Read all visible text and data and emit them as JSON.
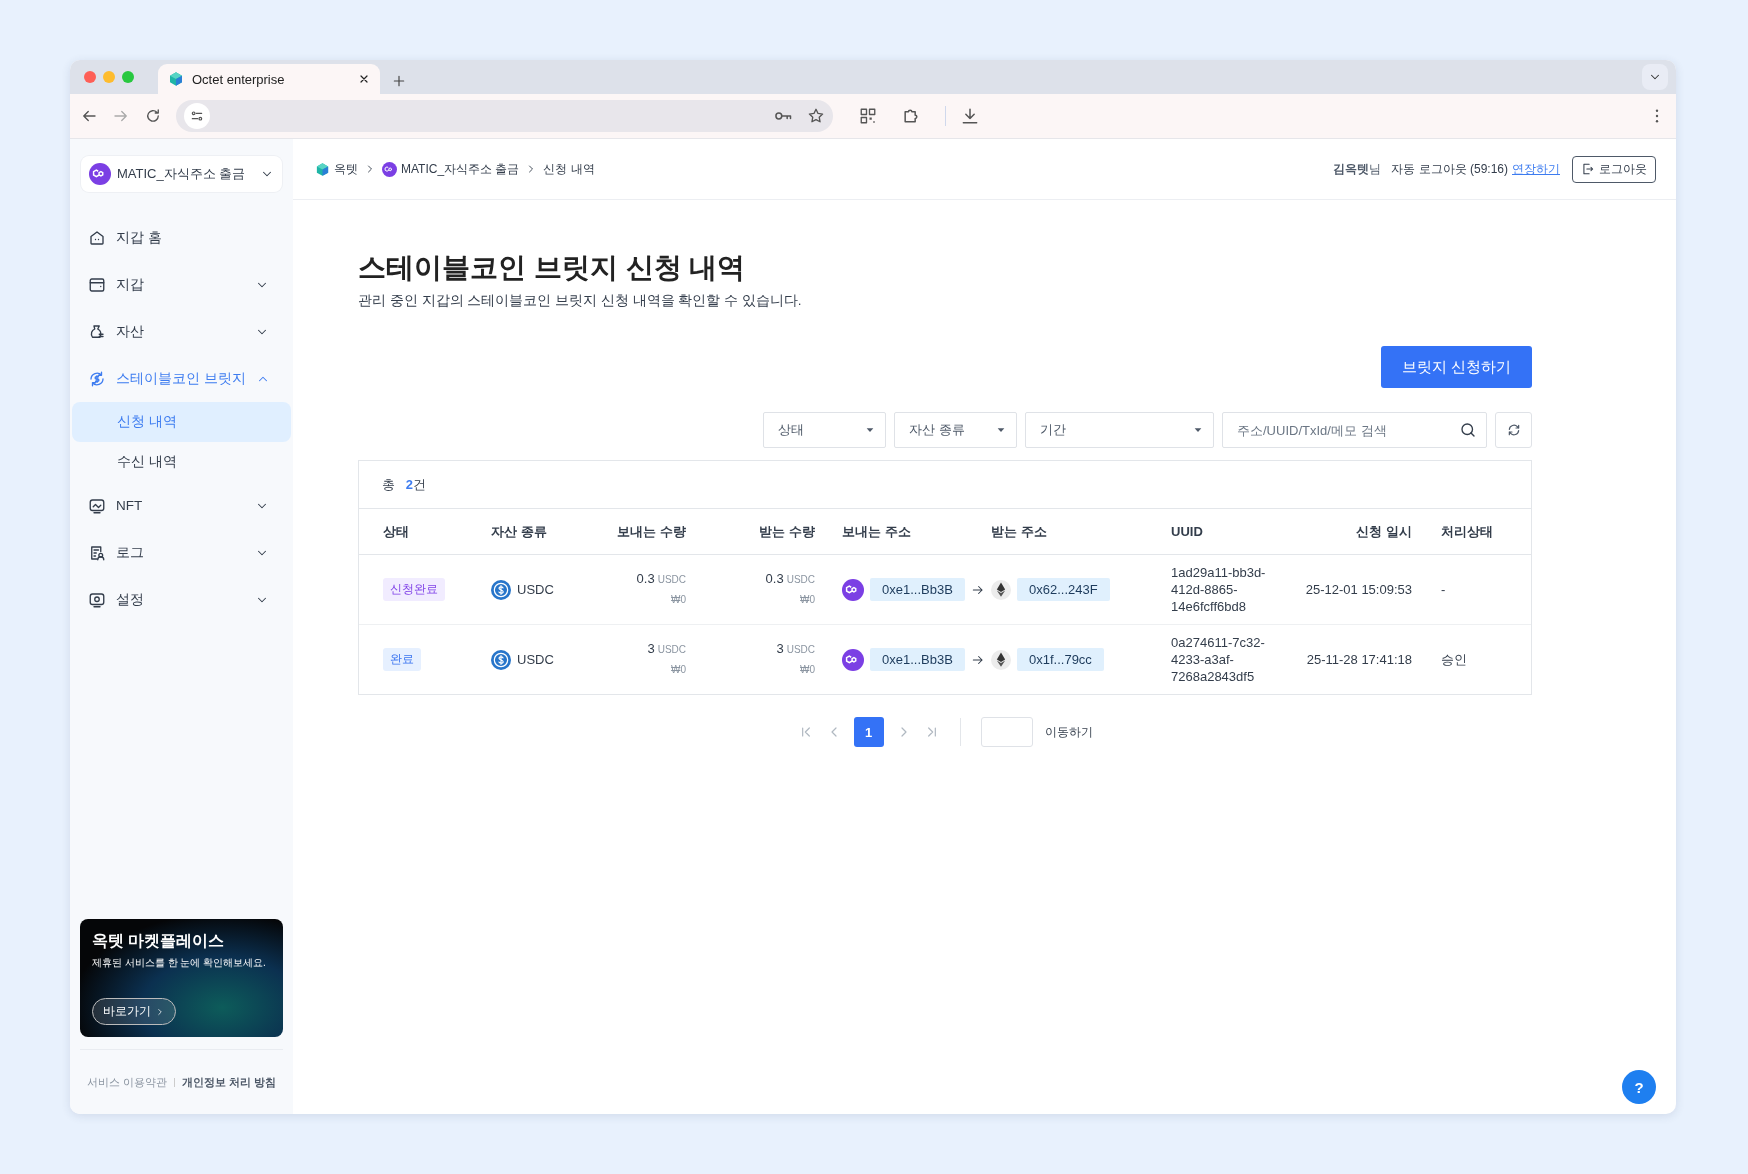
{
  "browser": {
    "tab_title": "Octet enterprise"
  },
  "sidebar": {
    "wallet_selector": "MATIC_자식주소 출금",
    "items": [
      {
        "label": "지갑 홈",
        "kind": "link",
        "selected": false
      },
      {
        "label": "지갑",
        "kind": "group",
        "expanded": false,
        "selected": false
      },
      {
        "label": "자산",
        "kind": "group",
        "expanded": false,
        "selected": false
      },
      {
        "label": "스테이블코인 브릿지",
        "kind": "group",
        "expanded": true,
        "selected": true,
        "children": [
          {
            "label": "신청 내역",
            "selected": true
          },
          {
            "label": "수신 내역",
            "selected": false
          }
        ]
      },
      {
        "label": "NFT",
        "kind": "group",
        "expanded": false,
        "selected": false
      },
      {
        "label": "로그",
        "kind": "group",
        "expanded": false,
        "selected": false
      },
      {
        "label": "설정",
        "kind": "group",
        "expanded": false,
        "selected": false
      }
    ],
    "banner": {
      "title": "옥텟 마켓플레이스",
      "text": "제휴된 서비스를 한 눈에 확인해보세요.",
      "button": "바로가기"
    },
    "footer_links": [
      {
        "label": "서비스 이용약관",
        "emphasized": false
      },
      {
        "label": "개인정보 처리 방침",
        "emphasized": true
      }
    ]
  },
  "header": {
    "breadcrumb": [
      "옥텟",
      "MATIC_자식주소 출금",
      "신청 내역"
    ],
    "user": "**김옥텟**님",
    "auto_logout": "자동 로그아웃 (59:16)",
    "extend_link": "연장하기",
    "logout_button": "로그아웃"
  },
  "page": {
    "title": "스테이블코인 브릿지 신청 내역",
    "description": "관리 중인 지갑의 스테이블코인 브릿지 신청 내역을 확인할 수 있습니다.",
    "primary_button": "브릿지 신청하기",
    "filters": [
      {
        "label": "상태"
      },
      {
        "label": "자산 종류"
      },
      {
        "label": "기간"
      }
    ],
    "search": {
      "placeholder": "주소/UUID/TxId/메모 검색"
    },
    "total": "총 **2**건",
    "table": {
      "columns": [
        "상태",
        "자산 종류",
        "보내는 수량",
        "받는 수량",
        "보내는 주소",
        "받는 주소",
        "UUID",
        "신청 일시",
        "처리상태"
      ],
      "rows": [
        {
          "status": {
            "text": "신청완료",
            "kind": "requested"
          },
          "asset": "USDC",
          "send_amount": "0.3",
          "send_unit": "USDC",
          "send_krw": "₩0",
          "receive_amount": "0.3",
          "receive_unit": "USDC",
          "receive_krw": "₩0",
          "from_address": "0xe1...Bb3B",
          "to_address": "0x62...243F",
          "uuid": "1ad29a11-bb3d-412d-8865-14e6fcff6bd8",
          "requested_at": "25-12-01 15:09:53",
          "processing": "-"
        },
        {
          "status": {
            "text": "완료",
            "kind": "done"
          },
          "asset": "USDC",
          "send_amount": "3",
          "send_unit": "USDC",
          "send_krw": "₩0",
          "receive_amount": "3",
          "receive_unit": "USDC",
          "receive_krw": "₩0",
          "from_address": "0xe1...Bb3B",
          "to_address": "0x1f...79cc",
          "uuid": "0a274611-7c32-4233-a3af-7268a2843df5",
          "requested_at": "25-11-28 17:41:18",
          "processing": "승인"
        }
      ]
    },
    "pagination": {
      "first": {
        "disabled": true
      },
      "prev": {
        "disabled": true
      },
      "pages": [
        {
          "label": "1",
          "selected": true
        }
      ],
      "next": {
        "disabled": true
      },
      "last": {
        "disabled": true
      },
      "go_button": "이동하기"
    }
  },
  "help_button": "?"
}
